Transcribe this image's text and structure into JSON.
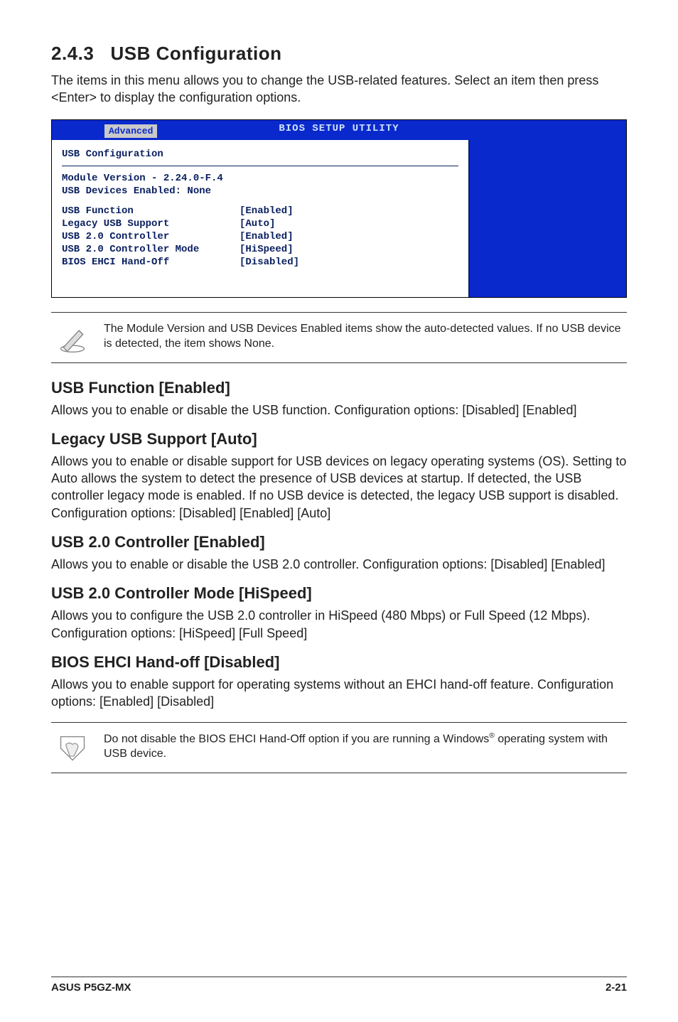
{
  "section": {
    "number": "2.4.3",
    "title": "USB Configuration",
    "intro": "The items in this menu allows you to change the USB-related features. Select an item then press <Enter> to display the configuration options."
  },
  "bios": {
    "header_title": "BIOS SETUP UTILITY",
    "tab": "Advanced",
    "panel_title": "USB Configuration",
    "module_line": "Module Version - 2.24.0-F.4",
    "devices_line": "USB Devices Enabled: None",
    "rows": [
      {
        "k": "USB Function",
        "v": "[Enabled]"
      },
      {
        "k": "Legacy USB Support",
        "v": "[Auto]"
      },
      {
        "k": "USB 2.0 Controller",
        "v": "[Enabled]"
      },
      {
        "k": "USB 2.0 Controller Mode",
        "v": "[HiSpeed]"
      },
      {
        "k": "BIOS EHCI Hand-Off",
        "v": "[Disabled]"
      }
    ]
  },
  "note1": "The Module Version and USB Devices Enabled items show the auto-detected values. If no USB device is detected, the item shows None.",
  "features": [
    {
      "title": "USB Function [Enabled]",
      "body": "Allows you to enable or disable the USB function. Configuration options: [Disabled] [Enabled]"
    },
    {
      "title": "Legacy USB Support [Auto]",
      "body": "Allows you to enable or disable support for USB devices on legacy operating systems (OS). Setting to Auto allows the system to detect the presence of USB devices at startup. If detected, the USB controller legacy mode is enabled. If no USB device is detected, the legacy USB support is disabled. Configuration options: [Disabled] [Enabled] [Auto]"
    },
    {
      "title": "USB 2.0 Controller [Enabled]",
      "body": "Allows you to enable or disable the USB 2.0 controller. Configuration options: [Disabled] [Enabled]"
    },
    {
      "title": "USB 2.0 Controller Mode [HiSpeed]",
      "body": "Allows you to configure the USB 2.0 controller in HiSpeed (480 Mbps) or Full Speed (12 Mbps). Configuration options: [HiSpeed] [Full Speed]"
    },
    {
      "title": "BIOS EHCI Hand-off [Disabled]",
      "body": "Allows you to enable support for operating systems without an EHCI hand-off feature. Configuration options: [Enabled] [Disabled]"
    }
  ],
  "note2_pre": "Do not disable the BIOS EHCI Hand-Off option if you are running a Windows",
  "note2_post": " operating system with USB device.",
  "footer": {
    "left": "ASUS P5GZ-MX",
    "right": "2-21"
  }
}
